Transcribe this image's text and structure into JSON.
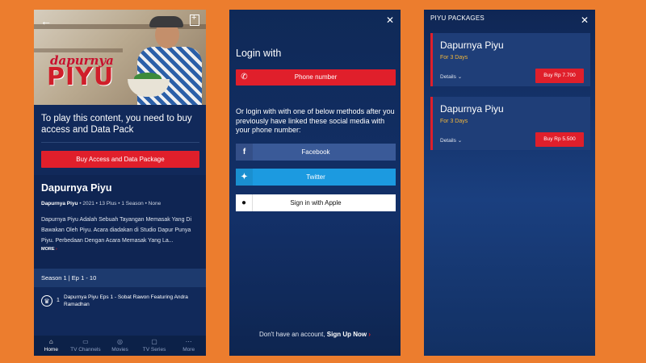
{
  "screen1": {
    "logo_small": "dapurnya",
    "logo_big": "PIYU",
    "access_message": "To play this content, you need to buy access and Data Pack",
    "buy_button": "Buy Access and Data Package",
    "show_title": "Dapurnya Piyu",
    "meta_title": "Dapurnya Piyu",
    "meta_rest": " • 2021 • 13 Plus • 1 Season • None",
    "description": "Dapurnya Piyu Adalah Sebuah Tayangan Memasak Yang Di Bawakan Oleh Piyu. Acara diadakan di Studio Dapur Punya Piyu. Perbedaan Dengan Acara Memasak Yang La...",
    "more": "MORE",
    "season": "Season 1  |  Ep 1 - 10",
    "episode_number": "1",
    "episode_title": "Dapurnya Piyu Eps 1 - Sobat Rawon Featuring Andra Ramadhan",
    "nav": [
      {
        "label": "Home",
        "icon": "home-icon"
      },
      {
        "label": "TV Channels",
        "icon": "tv-icon"
      },
      {
        "label": "Movies",
        "icon": "movie-icon"
      },
      {
        "label": "TV Series",
        "icon": "series-icon"
      },
      {
        "label": "More",
        "icon": "more-icon"
      }
    ]
  },
  "screen2": {
    "title": "Login with",
    "phone_button": "Phone number",
    "or_text": "Or login with with one of below methods after you previously have linked these social media with your phone number:",
    "facebook": "Facebook",
    "twitter": "Twitter",
    "apple": "Sign in with Apple",
    "no_account": "Don't have an account, ",
    "signup": "Sign Up Now"
  },
  "screen3": {
    "header": "PIYU PACKAGES",
    "packages": [
      {
        "title": "Dapurnya Piyu",
        "duration": "For 3 Days",
        "details": "Details",
        "price": "Buy Rp 7.700"
      },
      {
        "title": "Dapurnya Piyu",
        "duration": "For 3 Days",
        "details": "Details",
        "price": "Buy Rp 5.500"
      }
    ]
  },
  "colors": {
    "background": "#ec7d2e",
    "accent_red": "#e01f2b",
    "navy": "#11295a",
    "gold": "#f3b73a"
  }
}
